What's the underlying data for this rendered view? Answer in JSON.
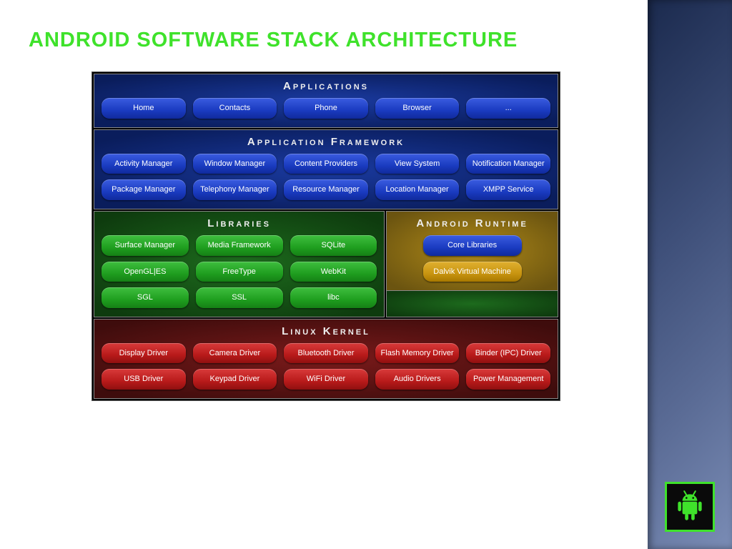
{
  "title": "ANDROID SOFTWARE STACK ARCHITECTURE",
  "layers": {
    "applications": {
      "title": "Applications",
      "items": [
        "Home",
        "Contacts",
        "Phone",
        "Browser",
        "..."
      ]
    },
    "framework": {
      "title": "Application Framework",
      "row1": [
        "Activity Manager",
        "Window Manager",
        "Content Providers",
        "View System",
        "Notification Manager"
      ],
      "row2": [
        "Package Manager",
        "Telephony Manager",
        "Resource Manager",
        "Location Manager",
        "XMPP Service"
      ]
    },
    "libraries": {
      "title": "Libraries",
      "row1": [
        "Surface Manager",
        "Media Framework",
        "SQLite"
      ],
      "row2": [
        "OpenGL|ES",
        "FreeType",
        "WebKit"
      ],
      "row3": [
        "SGL",
        "SSL",
        "libc"
      ]
    },
    "runtime": {
      "title": "Android Runtime",
      "items": [
        "Core Libraries",
        "Dalvik Virtual Machine"
      ]
    },
    "kernel": {
      "title": "Linux Kernel",
      "row1": [
        "Display Driver",
        "Camera Driver",
        "Bluetooth Driver",
        "Flash Memory Driver",
        "Binder (IPC) Driver"
      ],
      "row2": [
        "USB Driver",
        "Keypad Driver",
        "WiFi Driver",
        "Audio Drivers",
        "Power Management"
      ]
    }
  }
}
